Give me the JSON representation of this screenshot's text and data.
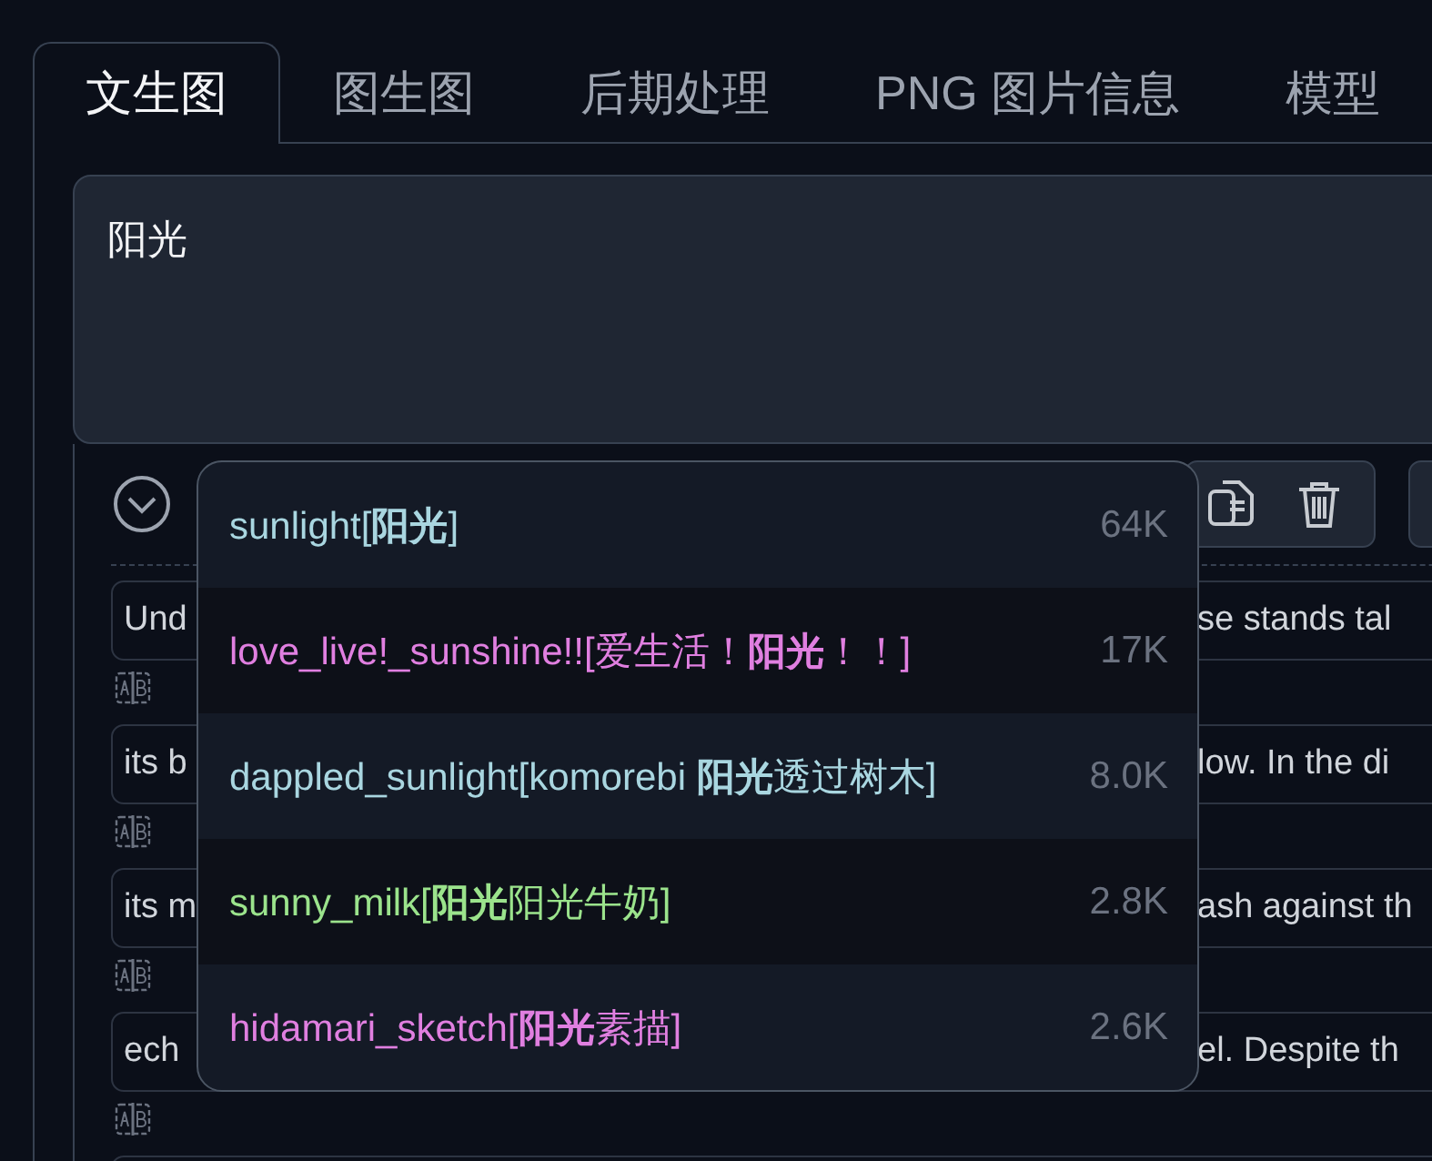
{
  "tabs": [
    {
      "label": "文生图",
      "selected": true
    },
    {
      "label": "图生图",
      "selected": false
    },
    {
      "label": "后期处理",
      "selected": false
    },
    {
      "label": "PNG 图片信息",
      "selected": false
    },
    {
      "label": "模型",
      "selected": false
    }
  ],
  "prompt": {
    "value": "阳光"
  },
  "prompt_rows": [
    {
      "left": "Und",
      "right": "se stands tal"
    },
    {
      "left": "its b",
      "right": "low. In the di"
    },
    {
      "left": "its m",
      "right": "ash against th"
    },
    {
      "left": "ech",
      "right": "el. Despite th"
    }
  ],
  "autocomplete": [
    {
      "text": "sunlight[**阳光**]",
      "count": "64K",
      "color": "#a9d6e0"
    },
    {
      "text": "love_live!_sunshine!![爱生活！**阳光**！！]",
      "count": "17K",
      "color": "#e07fe0"
    },
    {
      "text": "dappled_sunlight[komorebi **阳光**透过树木]",
      "count": "8.0K",
      "color": "#a9d6e0"
    },
    {
      "text": "sunny_milk[**阳光**阳光牛奶]",
      "count": "2.8K",
      "color": "#9be38c"
    },
    {
      "text": "hidamari_sketch[**阳光**素描]",
      "count": "2.6K",
      "color": "#e07fe0"
    }
  ]
}
